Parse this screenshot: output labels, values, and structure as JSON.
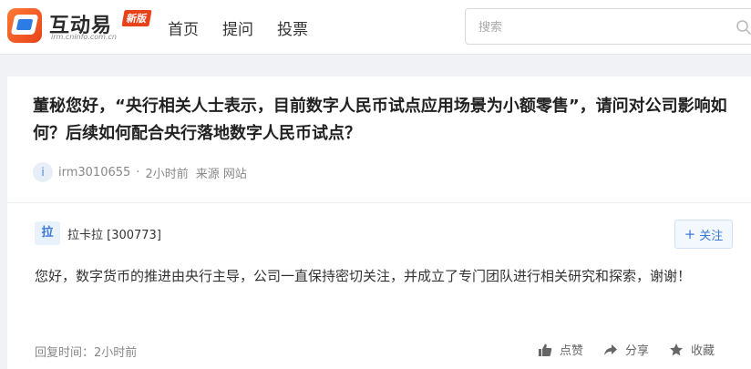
{
  "header": {
    "logo_title": "互动易",
    "logo_badge": "新版",
    "logo_subtitle": "irm.cninfo.com.cn",
    "nav": [
      "首页",
      "提问",
      "投票"
    ],
    "search_placeholder": "搜索"
  },
  "question": {
    "title": "董秘您好，“央行相关人士表示，目前数字人民币试点应用场景为小额零售”，请问对公司影响如何？后续如何配合央行落地数字人民币试点？",
    "asker_avatar": "i",
    "asker": "irm3010655",
    "time": "2小时前",
    "source": "来源 网站"
  },
  "answer": {
    "company_badge": "拉",
    "company": "拉卡拉 [300773]",
    "follow_label": "关注",
    "body": "您好，数字货币的推进由央行主导，公司一直保持密切关注，并成立了专门团队进行相关研究和探索，谢谢！",
    "reply_time": "回复时间：2小时前",
    "actions": {
      "like": "点赞",
      "share": "分享",
      "favorite": "收藏"
    }
  },
  "colors": {
    "brand_orange": "#e8421a",
    "accent_blue": "#3a78d8"
  }
}
